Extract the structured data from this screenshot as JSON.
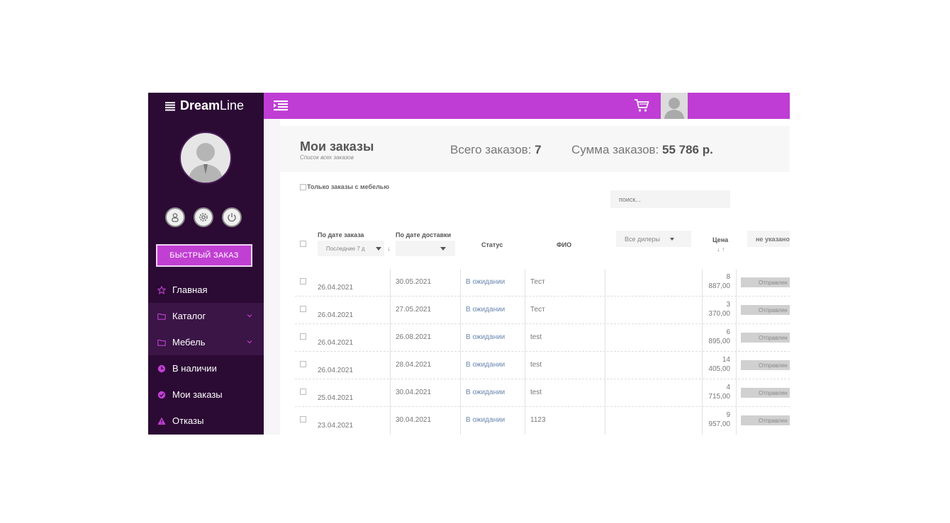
{
  "app": {
    "brand_bold": "Dream",
    "brand_light": "Line"
  },
  "sidebar": {
    "quick_order": "БЫСТРЫЙ ЗАКАЗ",
    "menu": [
      {
        "label": "Главная",
        "icon": "star-icon"
      },
      {
        "label": "Каталог",
        "icon": "folder-icon",
        "has_submenu": true
      },
      {
        "label": "Мебель",
        "icon": "folder-icon",
        "has_submenu": true
      },
      {
        "label": "В наличии",
        "icon": "clock-icon"
      },
      {
        "label": "Мои заказы",
        "icon": "check-circle-icon"
      },
      {
        "label": "Отказы",
        "icon": "warning-icon"
      }
    ]
  },
  "colors": {
    "accent": "#bf3dd4",
    "sidebar": "#2b0a34",
    "status_link": "#6a88b0"
  },
  "page": {
    "title": "Мои заказы",
    "subtitle": "Список всех заказов",
    "total_orders_label": "Всего заказов:",
    "total_orders_value": "7",
    "total_sum_label": "Сумма заказов:",
    "total_sum_value": "55 786 р."
  },
  "filters": {
    "furniture_only": "Только заказы с мебелью",
    "search_placeholder": "поиск..."
  },
  "table": {
    "headers": {
      "order_date": "По дате заказа",
      "delivery_date": "По дате доставки",
      "status": "Статус",
      "name": "ФИО",
      "price": "Цена"
    },
    "order_date_filter": "Последние 7 д",
    "dealers_filter": "Все дилеры",
    "unspecified_filter": "не указано",
    "sort_arrows": "↓ ↑",
    "rows": [
      {
        "order_date": "26.04.2021",
        "delivery_date": "30.05.2021",
        "status": "В ожидании",
        "name": "Тест",
        "price_top": "8",
        "price_bottom": "887,00",
        "action": "Отправлен"
      },
      {
        "order_date": "26.04.2021",
        "delivery_date": "27.05.2021",
        "status": "В ожидании",
        "name": "Тест",
        "price_top": "3",
        "price_bottom": "370,00",
        "action": "Отправлен"
      },
      {
        "order_date": "26.04.2021",
        "delivery_date": "26.08.2021",
        "status": "В ожидании",
        "name": "test",
        "price_top": "6",
        "price_bottom": "895,00",
        "action": "Отправлен"
      },
      {
        "order_date": "26.04.2021",
        "delivery_date": "28.04.2021",
        "status": "В ожидании",
        "name": "test",
        "price_top": "14",
        "price_bottom": "405,00",
        "action": "Отправлен"
      },
      {
        "order_date": "25.04.2021",
        "delivery_date": "30.04.2021",
        "status": "В ожидании",
        "name": "test",
        "price_top": "4",
        "price_bottom": "715,00",
        "action": "Отправлен"
      },
      {
        "order_date": "23.04.2021",
        "delivery_date": "30.04.2021",
        "status": "В ожидании",
        "name": "1123",
        "price_top": "9",
        "price_bottom": "957,00",
        "action": "Отправлен"
      }
    ]
  }
}
